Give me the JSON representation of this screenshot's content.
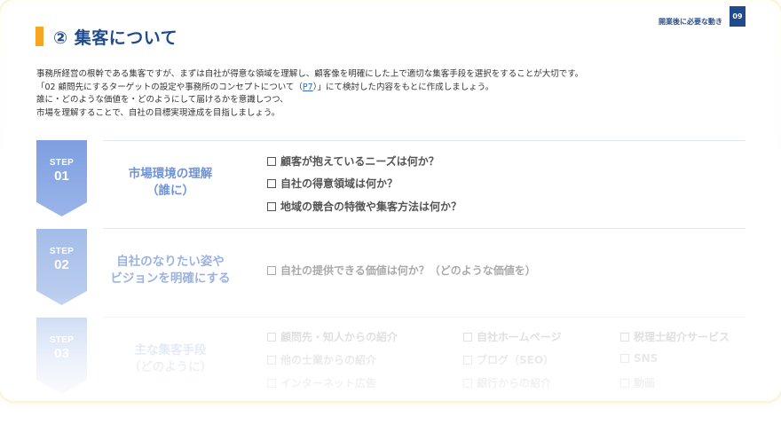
{
  "header": {
    "title": "② 集客について",
    "section_label": "開業後に必要な動き",
    "page_number": "09"
  },
  "intro": {
    "line1": "事務所経営の根幹である集客ですが、まずは自社が得意な領域を理解し、顧客像を明確にした上で適切な集客手段を選択をすることが大切です。",
    "line2_before": "「02 顧問先にするターゲットの設定や事務所のコンセプトについて（",
    "line2_link": "P7",
    "line2_after": "）」にて検討した内容をもとに作成しましょう。",
    "line3": "誰に・どのような価値を・どのようにして届けるかを意識しつつ、",
    "line4": "市場を理解することで、自社の目標実現達成を目指しましょう。"
  },
  "steps": [
    {
      "step_word": "STEP",
      "step_num": "01",
      "label_line1": "市場環境の理解",
      "label_line2": "（誰に）",
      "checks": [
        "顧客が抱えているニーズは何か？",
        "自社の得意領域は何か？",
        "地域の競合の特徴や集客方法は何か？"
      ]
    },
    {
      "step_word": "STEP",
      "step_num": "02",
      "label_line1": "自社のなりたい姿や",
      "label_line2": "ビジョンを明確にする",
      "checks": [
        "自社の提供できる価値は何か？（どのような価値を）"
      ]
    },
    {
      "step_word": "STEP",
      "step_num": "03",
      "label_line1": "主な集客手段",
      "label_line2": "（どのように）",
      "checks_col1": [
        "顧問先・知人からの紹介",
        "他の士業からの紹介",
        "インターネット広告"
      ],
      "checks_col2": [
        "自社ホームページ",
        "ブログ（SEO）",
        "銀行からの紹介"
      ],
      "checks_col3": [
        "税理士紹介サービス",
        "SNS",
        "動画"
      ]
    }
  ],
  "colors": {
    "accent_orange": "#f6a623",
    "title_blue": "#1f4a8c",
    "step1_badge": "#7d9ee0",
    "step2_badge": "#a6bfe8",
    "step3_badge": "#c8d8f2"
  }
}
